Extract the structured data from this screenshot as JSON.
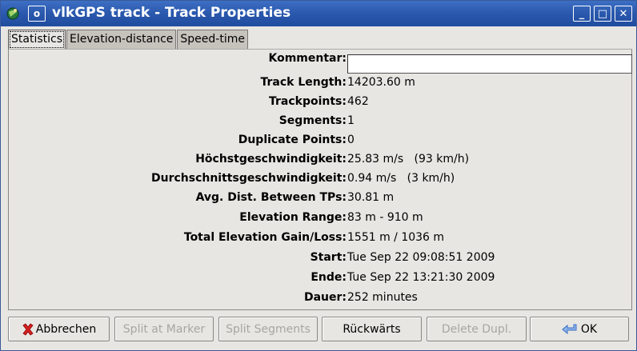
{
  "window": {
    "title": "vlkGPS track - Track Properties",
    "menu_icon": "o",
    "controls": {
      "minimize": "_",
      "maximize": "□",
      "close": "✕"
    }
  },
  "tabs": [
    {
      "label": "Statistics",
      "active": true
    },
    {
      "label": "Elevation-distance",
      "active": false
    },
    {
      "label": "Speed-time",
      "active": false
    }
  ],
  "stats": {
    "comment_label": "Kommentar:",
    "comment_value": "",
    "rows": [
      {
        "label": "Track Length:",
        "value": "14203.60 m"
      },
      {
        "label": "Trackpoints:",
        "value": "462"
      },
      {
        "label": "Segments:",
        "value": "1"
      },
      {
        "label": "Duplicate Points:",
        "value": "0"
      },
      {
        "label": "Höchstgeschwindigkeit:",
        "value": "25.83 m/s   (93 km/h)"
      },
      {
        "label": "Durchschnittsgeschwindigkeit:",
        "value": "0.94 m/s   (3 km/h)"
      },
      {
        "label": "Avg. Dist. Between TPs:",
        "value": "30.81 m"
      },
      {
        "label": "Elevation Range:",
        "value": "83 m - 910 m"
      },
      {
        "label": "Total Elevation Gain/Loss:",
        "value": "1551 m / 1036 m"
      },
      {
        "label": "Start:",
        "value": "Tue Sep 22 09:08:51 2009"
      },
      {
        "label": "Ende:",
        "value": "Tue Sep 22 13:21:30 2009"
      },
      {
        "label": "Dauer:",
        "value": "252 minutes"
      }
    ]
  },
  "buttons": {
    "cancel": "Abbrechen",
    "split_marker": "Split at Marker",
    "split_segments": "Split Segments",
    "reverse": "Rückwärts",
    "delete_dupl": "Delete Dupl.",
    "ok": "OK"
  },
  "colors": {
    "titlebar": "#2a58ad",
    "cancel_icon": "#d42020",
    "ok_icon": "#3a6fc8"
  }
}
